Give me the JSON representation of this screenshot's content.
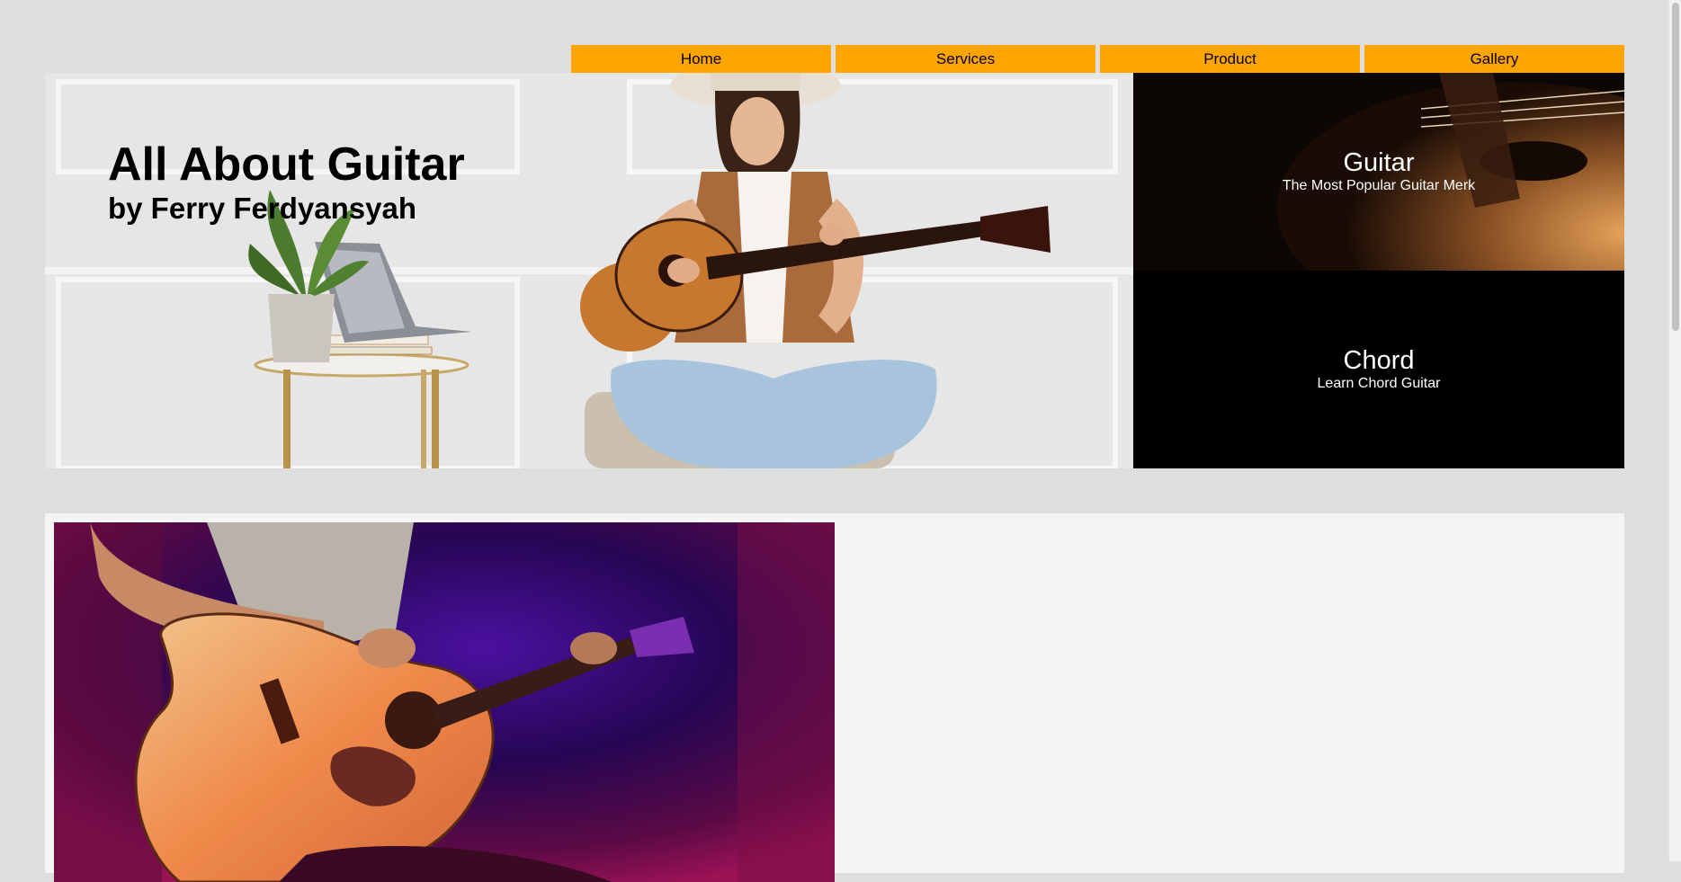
{
  "nav": {
    "items": [
      {
        "label": "Home"
      },
      {
        "label": "Services"
      },
      {
        "label": "Product"
      },
      {
        "label": "Gallery"
      }
    ]
  },
  "hero": {
    "title": "All About Guitar",
    "subtitle": "by Ferry Ferdyansyah"
  },
  "cards": {
    "guitar": {
      "title": "Guitar",
      "subtitle": "The Most Popular Guitar Merk"
    },
    "chord": {
      "title": "Chord",
      "subtitle": "Learn Chord Guitar"
    }
  },
  "colors": {
    "nav_bg": "#ffa500",
    "page_bg": "#dedede",
    "panel_bg": "#f4f4f4",
    "chord_bg": "#000000"
  }
}
